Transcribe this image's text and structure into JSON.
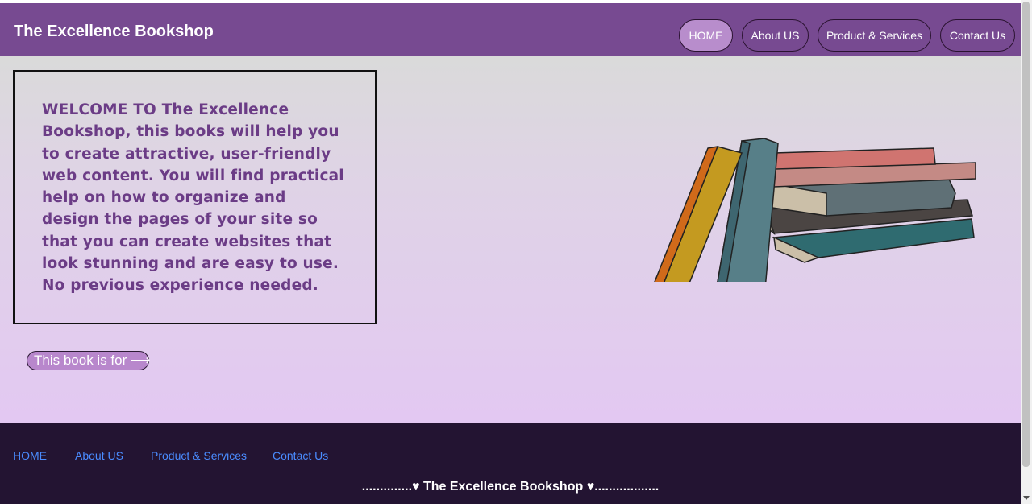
{
  "header": {
    "title": "The Excellence Bookshop",
    "nav": [
      {
        "label": "HOME",
        "active": true
      },
      {
        "label": "About US",
        "active": false
      },
      {
        "label": "Product & Services",
        "active": false
      },
      {
        "label": "Contact Us",
        "active": false
      }
    ]
  },
  "main": {
    "welcome_text": "WELCOME TO The Excellence Bookshop, this books will help you to create attractive, user-friendly web content. You will find practical help on how to organize and design the pages of your site so that you can create websites that look stunning and are easy to use. No previous experience needed.",
    "book_button_label": "This book is for ⟶",
    "illustration_icon": "stack-of-books-icon"
  },
  "footer": {
    "links": [
      "HOME",
      "About US",
      "Product & Services",
      "Contact Us"
    ],
    "tagline": "..............♥ The Excellence Bookshop ♥.................."
  },
  "colors": {
    "header_bg": "#774a91",
    "active_nav_bg": "#b88dcc",
    "welcome_text": "#6b3c86",
    "footer_bg": "#231432",
    "footer_link": "#4a8cff"
  }
}
